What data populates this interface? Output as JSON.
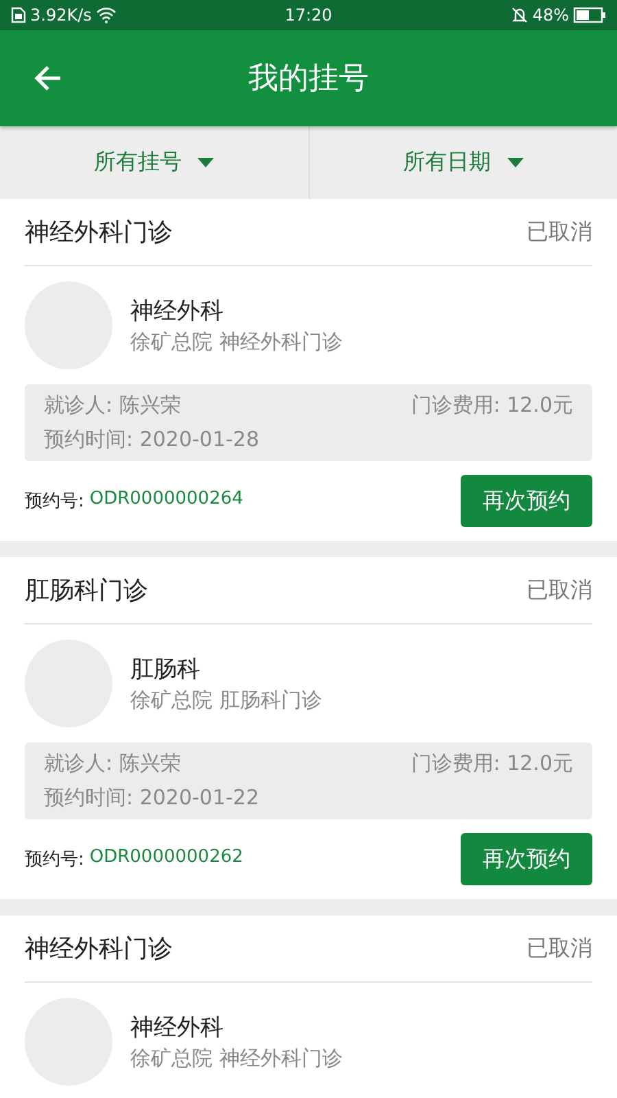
{
  "status_bar": {
    "network_speed": "3.92K/s",
    "time": "17:20",
    "battery": "48%"
  },
  "app_bar": {
    "title": "我的挂号"
  },
  "filters": [
    {
      "label": "所有挂号"
    },
    {
      "label": "所有日期"
    }
  ],
  "appointments": [
    {
      "clinic": "神经外科门诊",
      "status": "已取消",
      "department": "神经外科",
      "hospital": "徐矿总院 神经外科门诊",
      "patient": "就诊人: 陈兴荣",
      "fee": "门诊费用: 12.0元",
      "date": "预约时间: 2020-01-28",
      "order_label": "预约号:",
      "order_no": "ODR0000000264",
      "action": "再次预约"
    },
    {
      "clinic": "肛肠科门诊",
      "status": "已取消",
      "department": "肛肠科",
      "hospital": "徐矿总院 肛肠科门诊",
      "patient": "就诊人: 陈兴荣",
      "fee": "门诊费用: 12.0元",
      "date": "预约时间: 2020-01-22",
      "order_label": "预约号:",
      "order_no": "ODR0000000262",
      "action": "再次预约"
    },
    {
      "clinic": "神经外科门诊",
      "status": "已取消",
      "department": "神经外科",
      "hospital": "徐矿总院 神经外科门诊"
    }
  ]
}
